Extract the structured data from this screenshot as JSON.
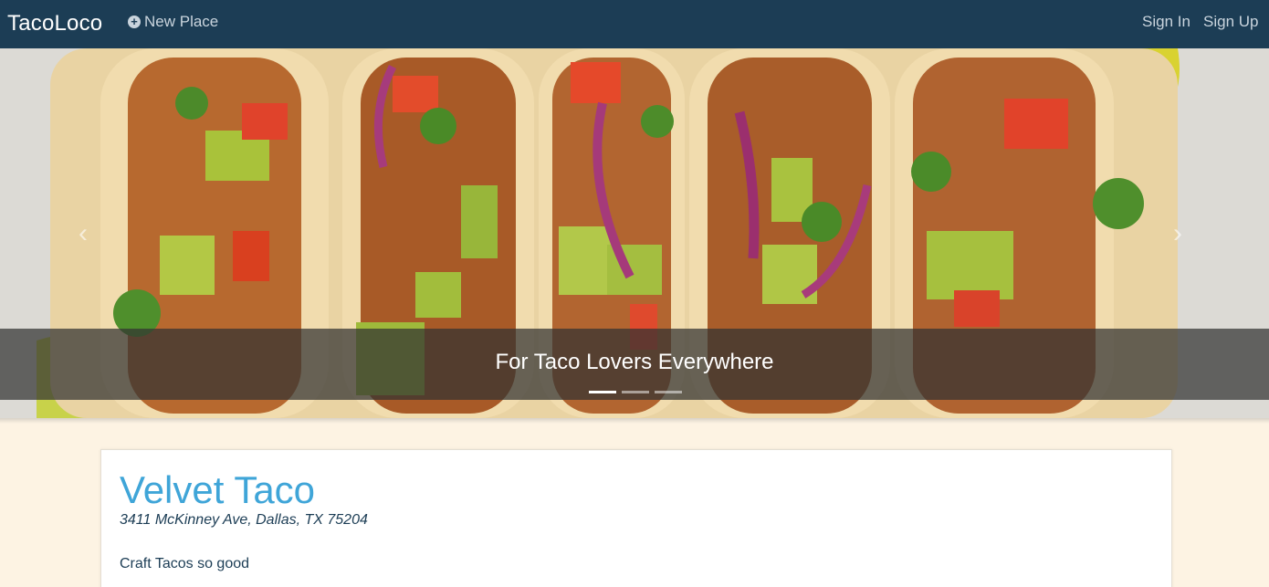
{
  "navbar": {
    "brand": "TacoLoco",
    "new_place_label": "New Place",
    "sign_in_label": "Sign In",
    "sign_up_label": "Sign Up"
  },
  "carousel": {
    "caption": "For Taco Lovers Everywhere",
    "slide_count": 3,
    "active_slide": 1,
    "prev_icon": "chevron-left-icon",
    "next_icon": "chevron-right-icon"
  },
  "place": {
    "name": "Velvet Taco",
    "address": "3411 McKinney Ave, Dallas, TX 75204",
    "description": "Craft Tacos so good"
  },
  "colors": {
    "navbar_bg": "#1c3d55",
    "accent": "#3fa5d8",
    "page_bg": "#fdf3e3"
  }
}
